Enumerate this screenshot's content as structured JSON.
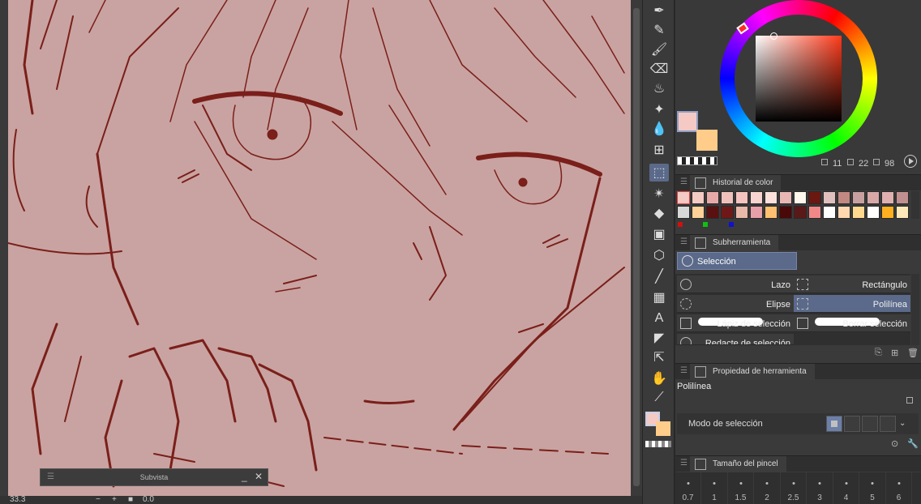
{
  "canvas": {
    "background": "#c9a3a1",
    "line_color": "#7a1f1a"
  },
  "status": {
    "zoom": "33.3",
    "rotation": "0.0"
  },
  "subview": {
    "title": "Subvista",
    "minimize_label": "_",
    "close_label": "✕"
  },
  "tools": [
    {
      "name": "pen-tool-icon",
      "glyph": "✒"
    },
    {
      "name": "pencil-tool-icon",
      "glyph": "✎"
    },
    {
      "name": "brush-tool-icon",
      "glyph": "🖌"
    },
    {
      "name": "eraser-tool-icon",
      "glyph": "⌫"
    },
    {
      "name": "airbrush-tool-icon",
      "glyph": "♨"
    },
    {
      "name": "decoration-tool-icon",
      "glyph": "✦"
    },
    {
      "name": "blend-tool-icon",
      "glyph": "💧"
    },
    {
      "name": "mesh-tool-icon",
      "glyph": "⊞"
    },
    {
      "name": "selection-tool-icon",
      "glyph": "⬚"
    },
    {
      "name": "auto-select-tool-icon",
      "glyph": "✴"
    },
    {
      "name": "fill-tool-icon",
      "glyph": "◆"
    },
    {
      "name": "gradient-tool-icon",
      "glyph": "▣"
    },
    {
      "name": "3d-tool-icon",
      "glyph": "⬡"
    },
    {
      "name": "line-tool-icon",
      "glyph": "╱"
    },
    {
      "name": "pattern-tool-icon",
      "glyph": "▦"
    },
    {
      "name": "text-tool-icon",
      "glyph": "A"
    },
    {
      "name": "frame-tool-icon",
      "glyph": "◤"
    },
    {
      "name": "operation-tool-icon",
      "glyph": "⇱"
    },
    {
      "name": "hand-tool-icon",
      "glyph": "✋"
    },
    {
      "name": "eyedropper-tool-icon",
      "glyph": "⟋"
    }
  ],
  "color_wheel": {
    "main_color": "#f5c9c4",
    "sub_color": "#ffcc8a",
    "h": "11",
    "s": "22",
    "v": "98"
  },
  "color_history": {
    "title": "Historial de color",
    "row1": [
      "#f5c9c4",
      "#f5c9c4",
      "#e8aaa8",
      "#f0c0bb",
      "#f5c4be",
      "#f8d4d0",
      "#fbe0dc",
      "#e8b8b4",
      "#fff8ec",
      "#6b1810",
      "#e0c0bc",
      "#c08880",
      "#c8a0a0",
      "#d8a8a8",
      "#e0b0b0",
      "#c09090"
    ],
    "row2": [
      "#d8d8d8",
      "#ffd098",
      "#5a1010",
      "#701818",
      "#e8b8a8",
      "#e8a0a8",
      "#ffc070",
      "#4a0808",
      "#5a1818",
      "#f08888",
      "#ffffff",
      "#ffd8b0",
      "#ffd890",
      "#ffffff",
      "#ffb020",
      "#ffe8b8"
    ]
  },
  "subtool": {
    "title": "Subherramienta",
    "group_label": "Selección",
    "items": [
      {
        "label": "Lazo",
        "name": "subtool-lasso"
      },
      {
        "label": "Rectángulo",
        "name": "subtool-rectangle"
      },
      {
        "label": "Elipse",
        "name": "subtool-ellipse"
      },
      {
        "label": "Polilínea",
        "name": "subtool-polyline"
      },
      {
        "label": "Lápiz de selección",
        "name": "subtool-selection-pen"
      },
      {
        "label": "Borrar selección",
        "name": "subtool-erase-selection"
      },
      {
        "label": "Redacte de selección",
        "name": "subtool-shrink-selection"
      }
    ]
  },
  "tool_property": {
    "title": "Propiedad de herramienta",
    "tool_name": "Polilínea",
    "selection_mode_label": "Modo de selección"
  },
  "brush_size": {
    "title": "Tamaño del pincel",
    "sizes": [
      "0.7",
      "1",
      "1.5",
      "2",
      "2.5",
      "3",
      "4",
      "5",
      "6"
    ]
  }
}
